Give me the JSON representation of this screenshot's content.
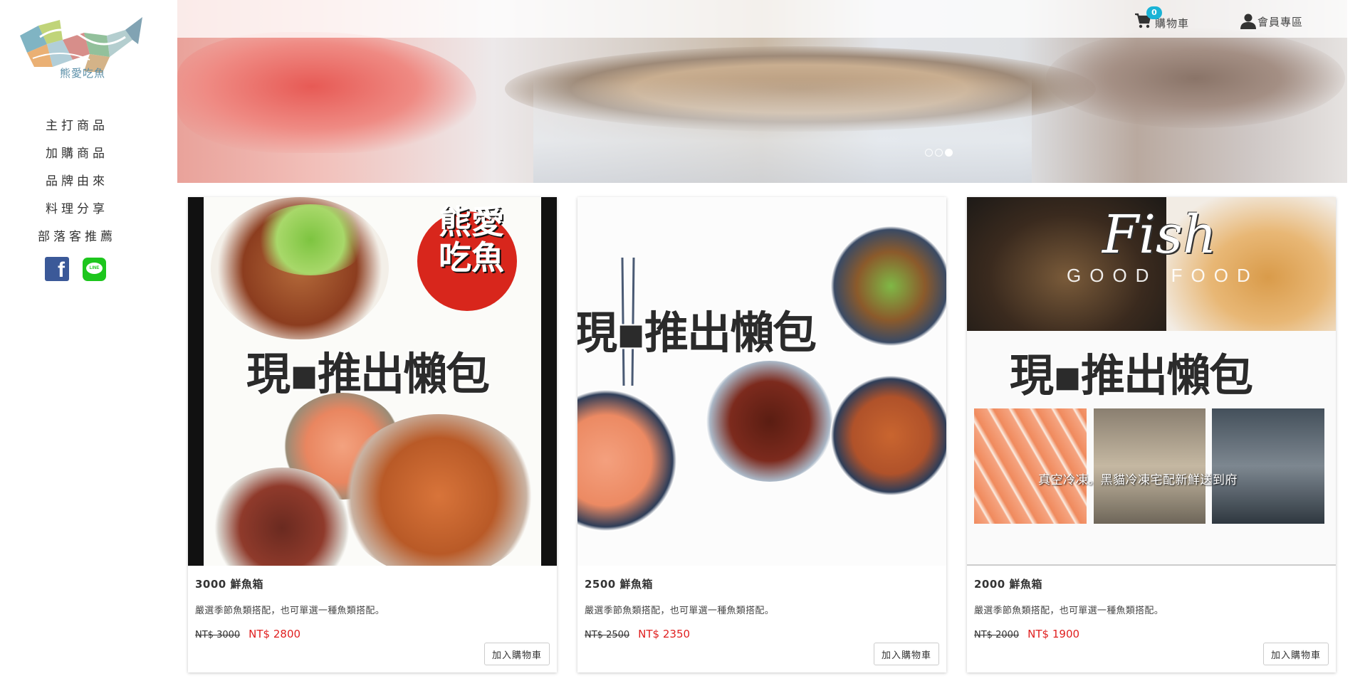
{
  "brand": {
    "logo_text": "熊愛吃魚"
  },
  "sidebar": {
    "items": [
      {
        "label": "主打商品"
      },
      {
        "label": "加購商品"
      },
      {
        "label": "品牌由來"
      },
      {
        "label": "料理分享"
      },
      {
        "label": "部落客推薦"
      }
    ],
    "social": {
      "facebook_icon": "f",
      "line_icon": "LINE"
    }
  },
  "header": {
    "cart_label": "購物車",
    "cart_count": "0",
    "member_label": "會員專區"
  },
  "carousel": {
    "slides": 3,
    "active_index": 2
  },
  "products": [
    {
      "title": "3000 鮮魚箱",
      "desc": "嚴選季節魚類搭配，也可單選一種魚類搭配。",
      "old_price": "NT$ 3000",
      "new_price": "NT$ 2800",
      "button": "加入購物車",
      "img_text": {
        "headline": "現▪推出懶包",
        "seal": "熊愛吃魚"
      }
    },
    {
      "title": "2500 鮮魚箱",
      "desc": "嚴選季節魚類搭配，也可單選一種魚類搭配。",
      "old_price": "NT$ 2500",
      "new_price": "NT$ 2350",
      "button": "加入購物車",
      "img_text": {
        "headline": "現▪推出懶包"
      }
    },
    {
      "title": "2000 鮮魚箱",
      "desc": "嚴選季節魚類搭配，也可單選一種魚類搭配。",
      "old_price": "NT$ 2000",
      "new_price": "NT$ 1900",
      "button": "加入購物車",
      "img_text": {
        "headline": "現▪推出懶包",
        "fish": "Fish",
        "good_food": "GOOD FOOD",
        "caption": "真空冷凍。黑貓冷凍宅配新鮮送到府"
      }
    }
  ],
  "colors": {
    "accent_badge": "#1ab3d6",
    "sale_price": "#e02020",
    "facebook": "#3b5998",
    "line": "#1dc61d"
  }
}
